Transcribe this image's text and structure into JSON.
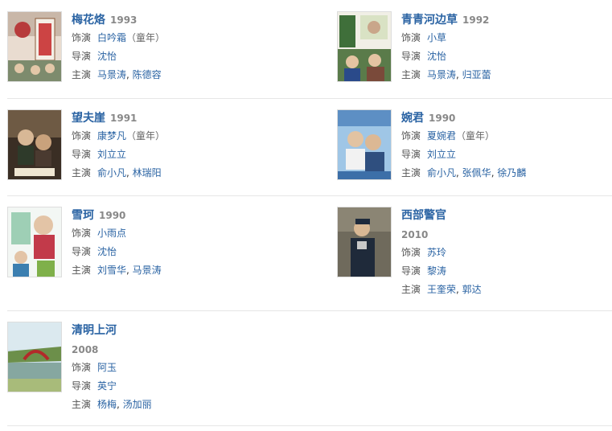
{
  "films": [
    {
      "title": "梅花烙",
      "year": "1993",
      "role_label": "饰演",
      "role": "白吟霜",
      "role_note": "（童年）",
      "director_label": "导演",
      "director": "沈怡",
      "cast_label": "主演",
      "cast": [
        "马景涛",
        "陈德容"
      ],
      "poster_icon": "poster-image"
    },
    {
      "title": "青青河边草",
      "year": "1992",
      "role_label": "饰演",
      "role": "小草",
      "role_note": "",
      "director_label": "导演",
      "director": "沈怡",
      "cast_label": "主演",
      "cast": [
        "马景涛",
        "归亚蕾"
      ],
      "poster_icon": "poster-image"
    },
    {
      "title": "望夫崖",
      "year": "1991",
      "role_label": "饰演",
      "role": "康梦凡",
      "role_note": "（童年）",
      "director_label": "导演",
      "director": "刘立立",
      "cast_label": "主演",
      "cast": [
        "俞小凡",
        "林瑞阳"
      ],
      "poster_icon": "poster-image"
    },
    {
      "title": "婉君",
      "year": "1990",
      "role_label": "饰演",
      "role": "夏婉君",
      "role_note": "（童年）",
      "director_label": "导演",
      "director": "刘立立",
      "cast_label": "主演",
      "cast": [
        "俞小凡",
        "张佩华",
        "徐乃麟"
      ],
      "poster_icon": "poster-image"
    },
    {
      "title": "雪珂",
      "year": "1990",
      "role_label": "饰演",
      "role": "小雨点",
      "role_note": "",
      "director_label": "导演",
      "director": "沈怡",
      "cast_label": "主演",
      "cast": [
        "刘雪华",
        "马景涛"
      ],
      "poster_icon": "poster-image"
    },
    {
      "title": "西部警官",
      "year": "2010",
      "role_label": "饰演",
      "role": "苏玲",
      "role_note": "",
      "director_label": "导演",
      "director": "黎涛",
      "cast_label": "主演",
      "cast": [
        "王奎荣",
        "郭达"
      ],
      "poster_icon": "poster-image"
    },
    {
      "title": "清明上河",
      "year": "2008",
      "role_label": "饰演",
      "role": "阿玉",
      "role_note": "",
      "director_label": "导演",
      "director": "英宁",
      "cast_label": "主演",
      "cast": [
        "杨梅",
        "汤加丽"
      ],
      "poster_icon": "poster-image"
    }
  ],
  "separator": ", "
}
